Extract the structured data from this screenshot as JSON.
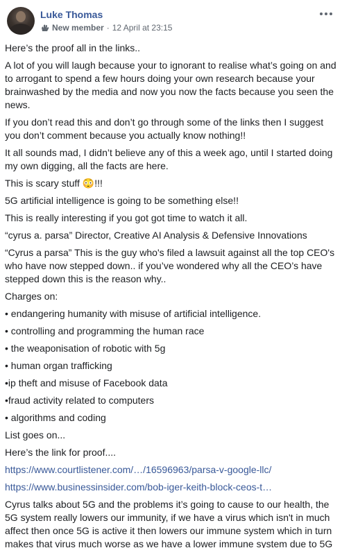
{
  "post": {
    "author": "Luke Thomas",
    "badge": "New member",
    "separator": "·",
    "timestamp": "12 April at 23:15",
    "more_icon": "more-dots-icon",
    "badge_icon": "wave-hand-icon",
    "paragraphs": [
      "Here’s the proof all in the links..",
      "A lot of you will laugh because your to ignorant to realise what’s going on and to arrogant to spend a few hours doing your own research because your brainwashed by the media and now you now the facts because you seen the news.",
      "If you don’t read this and don’t go through some of the links then I suggest you don’t comment because you actually know nothing!!",
      "It all sounds mad, I didn’t believe any of this a week ago, until I started doing my own digging, all the facts are here.",
      "This is scary stuff 😳!!!",
      "5G artificial intelligence is going to be something else!!",
      "This is really interesting if you got got time to watch it all.",
      "“cyrus a. parsa” Director, Creative AI Analysis & Defensive Innovations",
      "“Cyrus a parsa” This is the guy who's filed a lawsuit against all the top CEO's who have now stepped down.. if you’ve wondered why all the CEO’s have stepped down this is the reason why..",
      "Charges on:",
      "• endangering humanity with misuse of artificial intelligence.",
      "• controlling and programming the human race",
      "• the weaponisation of robotic with 5g",
      "• human organ trafficking",
      "•ip theft and misuse of Facebook data",
      "•fraud activity related to computers",
      "• algorithms and coding",
      "List goes on...",
      "Here’s the link for proof...."
    ],
    "links": [
      "https://www.courtlistener.com/…/16596963/parsa-v-google-llc/",
      "https://www.businessinsider.com/bob-iger-keith-block-ceos-t…"
    ],
    "closing": "Cyrus talks about 5G and the problems it’s going to cause to our health, the 5G system really lowers our immunity, if we have a virus which isn't in much affect then once 5G is active it then lowers our immune system which in turn makes that virus much worse as we have a lower immune system due to 5G"
  }
}
